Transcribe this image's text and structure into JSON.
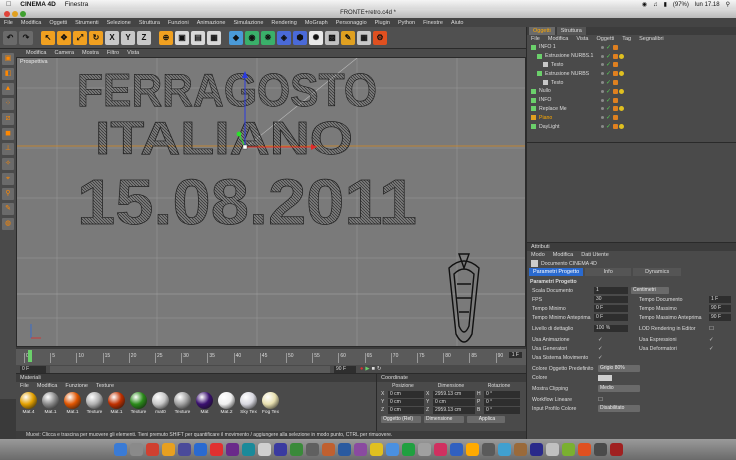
{
  "mac_menubar": {
    "app": "CINEMA 4D",
    "menu": "Finestra",
    "battery": "(97%)",
    "clock": "lun 17.18"
  },
  "window": {
    "title": "FRONTE+retro.c4d *"
  },
  "main_menu": [
    "File",
    "Modifica",
    "Oggetti",
    "Strumenti",
    "Selezione",
    "Struttura",
    "Funzioni",
    "Animazione",
    "Simulazione",
    "Rendering",
    "MoGraph",
    "Personaggio",
    "Plugin",
    "Python",
    "Finestre",
    "Aiuto"
  ],
  "toolbar_icons": [
    "undo-icon",
    "redo-icon",
    "select-icon",
    "move-icon",
    "scale-icon",
    "rotate-icon",
    "x-axis-icon",
    "y-axis-icon",
    "z-axis-icon",
    "coord-system-icon",
    "render-view-icon",
    "render-picture-icon",
    "render-settings-icon",
    "cube-icon",
    "nurbs-icon",
    "array-icon",
    "deformer-icon",
    "scene-icon",
    "light-icon",
    "camera-icon",
    "python-icon",
    "grid-icon",
    "layers-icon"
  ],
  "viewport": {
    "menu": [
      "Modifica",
      "Camera",
      "Mostra",
      "Filtro",
      "Vista"
    ],
    "label": "Prospettiva",
    "text_lines": [
      "FERRAGOSTO",
      "ITALIANO",
      "15.08.2011"
    ]
  },
  "timeline": {
    "ticks": [
      "0",
      "5",
      "10",
      "15",
      "20",
      "25",
      "30",
      "35",
      "40",
      "45",
      "50",
      "55",
      "60",
      "65",
      "70",
      "75",
      "80",
      "85",
      "90"
    ],
    "frame_marker": "1 F",
    "start": "0 F",
    "end": "90 F",
    "current_start": "0 F",
    "current_end": "90 F"
  },
  "materials": {
    "title": "Materiali",
    "menu": [
      "File",
      "Modifica",
      "Funzione",
      "Texture"
    ],
    "items": [
      {
        "name": "Mat.4",
        "color": "#e2a000"
      },
      {
        "name": "Mat.1",
        "color": "#8a8a8a"
      },
      {
        "name": "Mat.1",
        "color": "#e05500"
      },
      {
        "name": "Texture",
        "color": "#b0b0b0"
      },
      {
        "name": "Mat.1",
        "color": "#c03000"
      },
      {
        "name": "Texture",
        "color": "#2a8a1a"
      },
      {
        "name": "mat0",
        "color": "#c8c8c8"
      },
      {
        "name": "Texture",
        "color": "#a0a0a0"
      },
      {
        "name": "Mat",
        "color": "#3a1070"
      },
      {
        "name": "Mat.2",
        "color": "#f0f0f0"
      },
      {
        "name": "Sky Tex",
        "color": "#d8d8e0"
      },
      {
        "name": "Fog Tex",
        "color": "#e8e0b0"
      }
    ]
  },
  "coordinates": {
    "title": "Coordinate",
    "headers": [
      "Posizione",
      "Dimensione",
      "Rotazione"
    ],
    "rows": [
      {
        "axis": "X",
        "pos": "0 cm",
        "dim_axis": "X",
        "dim": "2959.13 cm",
        "rot_axis": "H",
        "rot": "0 °"
      },
      {
        "axis": "Y",
        "pos": "0 cm",
        "dim_axis": "Y",
        "dim": "0 cm",
        "rot_axis": "P",
        "rot": "0 °"
      },
      {
        "axis": "Z",
        "pos": "0 cm",
        "dim_axis": "Z",
        "dim": "2959.13 cm",
        "rot_axis": "B",
        "rot": "0 °"
      }
    ],
    "mode_select": "Oggetto (Rel)",
    "size_select": "Dimensione",
    "apply": "Applica"
  },
  "status": "Muovi: Clicca e trascina per muovere gli elementi. Tieni premuto SHIFT per quantificare il movimento / aggiungere alla selezione in modo punto, CTRL per rimuovere.",
  "objects_panel": {
    "tabs": [
      "Oggetti",
      "Struttura"
    ],
    "menu": [
      "File",
      "Modifica",
      "Vista",
      "Oggetti",
      "Tag",
      "Segnalibri"
    ],
    "rows": [
      {
        "name": "INFO 1",
        "indent": 0
      },
      {
        "name": "Estrusione NURBS.1",
        "indent": 1
      },
      {
        "name": "Testo",
        "indent": 2
      },
      {
        "name": "Estrusione NURBS",
        "indent": 1
      },
      {
        "name": "Testo",
        "indent": 2
      },
      {
        "name": "Nullo",
        "indent": 0
      },
      {
        "name": "INFO",
        "indent": 0
      },
      {
        "name": "Replace Me",
        "indent": 0
      },
      {
        "name": "Piano",
        "indent": 0
      },
      {
        "name": "DayLight",
        "indent": 0
      }
    ]
  },
  "attributes": {
    "title": "Attributi",
    "menu": [
      "Modo",
      "Modifica",
      "Dati Utente"
    ],
    "doc_title": "Documento CINEMA 4D",
    "tabs": [
      "Parametri Progetto",
      "Info",
      "Dynamics"
    ],
    "section": "Parametri Progetto",
    "scale_label": "Scala Documento",
    "scale_value": "1",
    "scale_unit": "Centimetri",
    "fps_label": "FPS",
    "fps": "30",
    "time_doc_label": "Tempo Documento",
    "time_doc": "1 F",
    "tmin_label": "Tempo Minimo",
    "tmin": "0 F",
    "tmax_label": "Tempo Massimo",
    "tmax": "90 F",
    "tmin_prev_label": "Tempo Minimo Anteprima",
    "tmin_prev": "0 F",
    "tmax_prev_label": "Tempo Massimo Anteprima",
    "tmax_prev": "90 F",
    "lod_label": "Livello di dettaglio",
    "lod": "100 %",
    "lod_render_label": "LOD Rendering in Editor",
    "use_anim": "Usa Animazione",
    "use_expr": "Usa Espressioni",
    "use_gen": "Usa Generatori",
    "use_def": "Usa Deformatori",
    "use_motion": "Usa Sistema Movimento",
    "obj_color_label": "Colore Oggetto Predefinito",
    "obj_color": "Grigio 80%",
    "color_label": "Colore",
    "clip_label": "Mostra Clipping",
    "clip": "Medio",
    "workflow_label": "Workflow Lineare",
    "profile_label": "Input Profilo Colore",
    "profile": "Disabilitato"
  },
  "dock_colors": [
    "#3a7bd5",
    "#8a8a8a",
    "#d04030",
    "#e8a020",
    "#4a4a9a",
    "#2a6ad0",
    "#e03030",
    "#6a2a8a",
    "#1a8a9a",
    "#d0d0d0",
    "#3a3aa0",
    "#3a8a3a",
    "#606060",
    "#c06030",
    "#2a5aa0",
    "#8a4aa0",
    "#e0c020",
    "#4a90e0",
    "#20a040",
    "#a0a0a0",
    "#d03060",
    "#3060c0",
    "#ffaa00",
    "#5a5a5a",
    "#40a0d0",
    "#9a6a3a",
    "#2a2a8a",
    "#c0c0c0",
    "#7ab030",
    "#e05020",
    "#4a4a4a",
    "#a02020"
  ]
}
